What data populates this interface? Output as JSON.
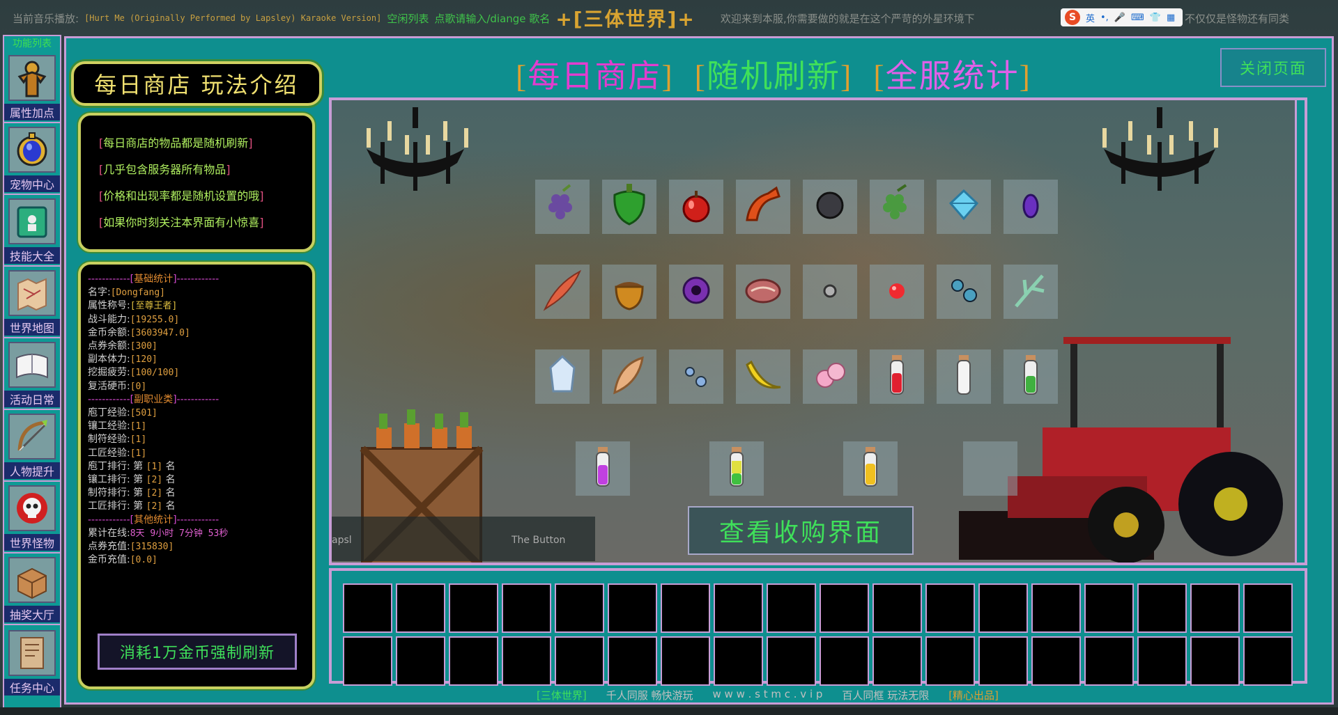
{
  "ticker": {
    "prefix": "当前音乐播放:",
    "song": "[Hurt Me (Originally Performed by Lapsley) Karaoke Version]",
    "playlist": "空闲列表",
    "request": "点歌请输入/diange 歌名",
    "brand": "+[三体世界]+",
    "welcome": "欢迎来到本服,你需要做的就是在这个严苛的外星环境下",
    "tail": "不仅仅是怪物还有同类"
  },
  "ime": {
    "logo": "S",
    "lang": "英",
    "icons": [
      "•,",
      "🎤",
      "⌨",
      "👕",
      "▦"
    ]
  },
  "sidebar": {
    "header": "功能列表",
    "items": [
      {
        "label": "属性加点",
        "icon": "statue-icon"
      },
      {
        "label": "宠物中心",
        "icon": "gem-amulet-icon"
      },
      {
        "label": "技能大全",
        "icon": "skill-book-icon"
      },
      {
        "label": "世界地图",
        "icon": "map-scroll-icon"
      },
      {
        "label": "活动日常",
        "icon": "open-book-icon"
      },
      {
        "label": "人物提升",
        "icon": "bow-icon"
      },
      {
        "label": "世界怪物",
        "icon": "skull-icon"
      },
      {
        "label": "抽奖大厅",
        "icon": "box-icon"
      },
      {
        "label": "任务中心",
        "icon": "quest-book-icon"
      }
    ]
  },
  "header": {
    "title1": "每日商店",
    "title2": "随机刷新",
    "title3": "全服统计",
    "close": "关闭页面"
  },
  "intro": {
    "title": "每日商店 玩法介绍",
    "lines": [
      "每日商店的物品都是随机刷新",
      "几乎包含服务器所有物品",
      "价格和出现率都是随机设置的哦",
      "如果你时刻关注本界面有小惊喜"
    ]
  },
  "stats": {
    "sec_basic": "基础统计",
    "name_k": "名字:",
    "name_v": "[Dongfang]",
    "title_k": "属性称号:",
    "title_v": "[至尊王者]",
    "power_k": "战斗能力:",
    "power_v": "[19255.0]",
    "gold_k": "金币余额:",
    "gold_v": "[3603947.0]",
    "points_k": "点券余额:",
    "points_v": "[300]",
    "stamina_k": "副本体力:",
    "stamina_v": "[120]",
    "dig_k": "挖掘疲劳:",
    "dig_v": "[100/100]",
    "revive_k": "复活硬币:",
    "revive_v": "[0]",
    "sec_job": "副职业类",
    "j1_k": "庖丁经验:",
    "j1_v": "[501]",
    "j2_k": "镶工经验:",
    "j2_v": "[1]",
    "j3_k": "制符经验:",
    "j3_v": "[1]",
    "j4_k": "工匠经验:",
    "j4_v": "[1]",
    "r1_k": "庖丁排行: 第",
    "r1_v": "[1]",
    "r1_s": "名",
    "r2_k": "镶工排行: 第",
    "r2_v": "[2]",
    "r2_s": "名",
    "r3_k": "制符排行: 第",
    "r3_v": "[2]",
    "r3_s": "名",
    "r4_k": "工匠排行: 第",
    "r4_v": "[2]",
    "r4_s": "名",
    "sec_other": "其他统计",
    "online_k": "累计在线:",
    "online_v": "8天 9小时 7分钟 53秒",
    "recharge_k": "点券充值:",
    "recharge_v": "[315830]",
    "goldre_k": "金币充值:",
    "goldre_v": "[0.0]",
    "force_btn": "消耗1万金币强制刷新"
  },
  "shop": {
    "slots": [
      {
        "icon": "grapes-purple-icon"
      },
      {
        "icon": "green-pepper-icon"
      },
      {
        "icon": "apple-icon"
      },
      {
        "icon": "shrimp-claw-icon"
      },
      {
        "icon": "coal-icon"
      },
      {
        "icon": "grapes-green-icon"
      },
      {
        "icon": "diamond-icon"
      },
      {
        "icon": "amethyst-icon"
      },
      {
        "icon": "feather-icon"
      },
      {
        "icon": "acorn-icon"
      },
      {
        "icon": "ender-pearl-icon"
      },
      {
        "icon": "raw-meat-icon"
      },
      {
        "icon": "iron-nugget-icon"
      },
      {
        "icon": "red-orb-icon"
      },
      {
        "icon": "blue-bubbles-icon"
      },
      {
        "icon": "herb-icon"
      },
      {
        "icon": "crystal-icon"
      },
      {
        "icon": "shell-icon"
      },
      {
        "icon": "water-drops-icon"
      },
      {
        "icon": "banana-icon"
      },
      {
        "icon": "pink-pearls-icon"
      },
      {
        "icon": "red-potion-icon"
      },
      {
        "icon": "white-potion-icon"
      },
      {
        "icon": "green-potion-icon"
      },
      {
        "icon": "purple-potion-icon"
      },
      {
        "icon": "yellow-green-potion-icon"
      },
      {
        "icon": "yellow-potion-icon"
      },
      {
        "icon": "empty-slot"
      }
    ],
    "tip_left": "apsl",
    "tip_right": "The Button",
    "view_btn": "查看收购界面"
  },
  "footer": {
    "brand": "[三体世界]",
    "slogan1": "千人同服 畅快游玩",
    "site": "w w w . s t m c . v i p",
    "slogan2": "百人同框 玩法无限",
    "quality": "[精心出品]"
  },
  "colors": {
    "frame": "#0e8f8f",
    "border": "#c89dd6",
    "accent_green": "#3fe05a"
  }
}
